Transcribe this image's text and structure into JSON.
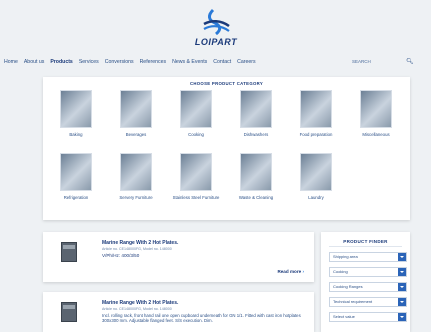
{
  "brand": {
    "name": "LOIPART"
  },
  "nav": {
    "items": [
      "Home",
      "About us",
      "Products",
      "Services",
      "Conversions",
      "References",
      "News & Events",
      "Contact",
      "Careers"
    ],
    "active": "Products",
    "search_label": "SEARCH"
  },
  "categories": {
    "title": "CHOOSE PRODUCT CATEGORY",
    "items": [
      {
        "label": "Baking"
      },
      {
        "label": "Beverages"
      },
      {
        "label": "Cooking"
      },
      {
        "label": "Dishwashers"
      },
      {
        "label": "Food preparation"
      },
      {
        "label": "Miscellaneous"
      },
      {
        "label": "Refrigeration"
      },
      {
        "label": "Servery Furniture"
      },
      {
        "label": "Stainless Steel Furniture"
      },
      {
        "label": "Waste & Cleaning"
      },
      {
        "label": "Laundry"
      }
    ]
  },
  "products": [
    {
      "title": "Marine Range With 2 Hot Plates.",
      "article": "Article no. CE148000FG, Model no. 148000",
      "spec": "V/Ph/Hz: 400/3/50",
      "read_more": "Read more"
    },
    {
      "title": "Marine Range With 2 Hot Plates.",
      "article": "Article no. CE148000FG, Model no. 148000",
      "desc": "Incl. rolling rack, front hand rail one open cupboard underneath for GN 1/1. Fitted with cast iron hotplates 300x300 mm. Adjustable flanged feet. S/S execution. Dim."
    }
  ],
  "finder": {
    "title": "PRODUCT FINDER",
    "selects": [
      {
        "value": "Shipping area"
      },
      {
        "value": "Cooking"
      },
      {
        "value": "Cooking Ranges"
      },
      {
        "value": "Technical requirement"
      },
      {
        "value": "Select value"
      }
    ]
  },
  "colors": {
    "brand": "#1b3a7a",
    "accent": "#2b64b8",
    "background": "#eef1f4"
  }
}
